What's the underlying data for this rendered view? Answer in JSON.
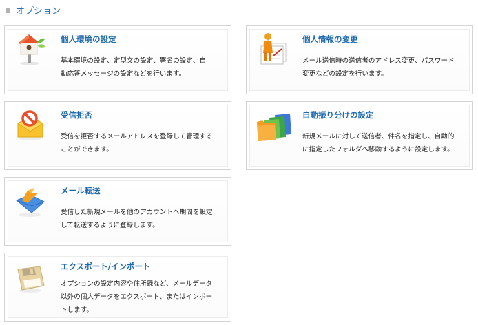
{
  "header": {
    "title": "オプション"
  },
  "cards": [
    {
      "title": "個人環境の設定",
      "icon": "birdhouse-icon",
      "desc": [
        "基本環境の設定、定型文の設定、署名の設定、自",
        "動応答メッセージの設定などを行います。"
      ]
    },
    {
      "title": "個人情報の変更",
      "icon": "person-profile-icon",
      "desc": [
        "メール送信時の送信者のアドレス変更、パスワード",
        "変更などの設定を行います。"
      ]
    },
    {
      "title": "受信拒否",
      "icon": "blocked-mail-icon",
      "desc": [
        "受信を拒否するメールアドレスを登録して管理する",
        "ことができます。"
      ]
    },
    {
      "title": "自動振り分けの設定",
      "icon": "folders-sort-icon",
      "desc": [
        "新規メールに対して送信者、件名を指定し、自動的",
        "に指定したフォルダへ移動するように設定します。"
      ]
    },
    {
      "title": "メール転送",
      "icon": "mail-forward-icon",
      "desc": [
        "受信した新規メールを他のアカウントへ期間を設定",
        "して転送するように登録します。"
      ]
    },
    {
      "title": "エクスポート/インポート",
      "icon": "floppy-disk-icon",
      "desc": [
        "オプションの設定内容や住所録など、メールデータ",
        "以外の個人データをエクスポート、またはインポー",
        "トします。"
      ]
    }
  ]
}
